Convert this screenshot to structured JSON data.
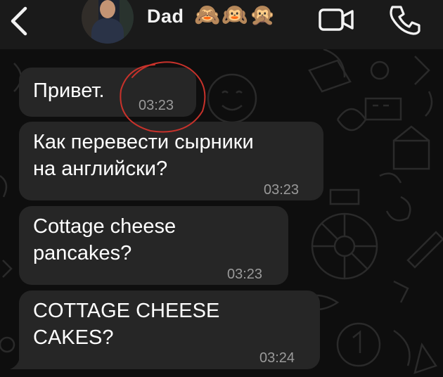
{
  "header": {
    "back_icon": "chevron-left-icon",
    "contact_name": "Dad",
    "emojis": "🙈🙉🙊",
    "video_icon": "video-camera-icon",
    "phone_icon": "phone-icon"
  },
  "messages": [
    {
      "text": "Привет.",
      "time": "03:23"
    },
    {
      "text": "Как перевести сырники\nна английски?",
      "time": "03:23"
    },
    {
      "text": "Cottage cheese\npancakes?",
      "time": "03:23"
    },
    {
      "text": "COTTAGE CHEESE\nCAKES?",
      "time": "03:24"
    }
  ],
  "colors": {
    "background": "#0e0e0e",
    "header": "#1a1a1a",
    "bubble": "#262626",
    "timestamp": "#9a9a9a",
    "annotation": "#c8322b"
  }
}
